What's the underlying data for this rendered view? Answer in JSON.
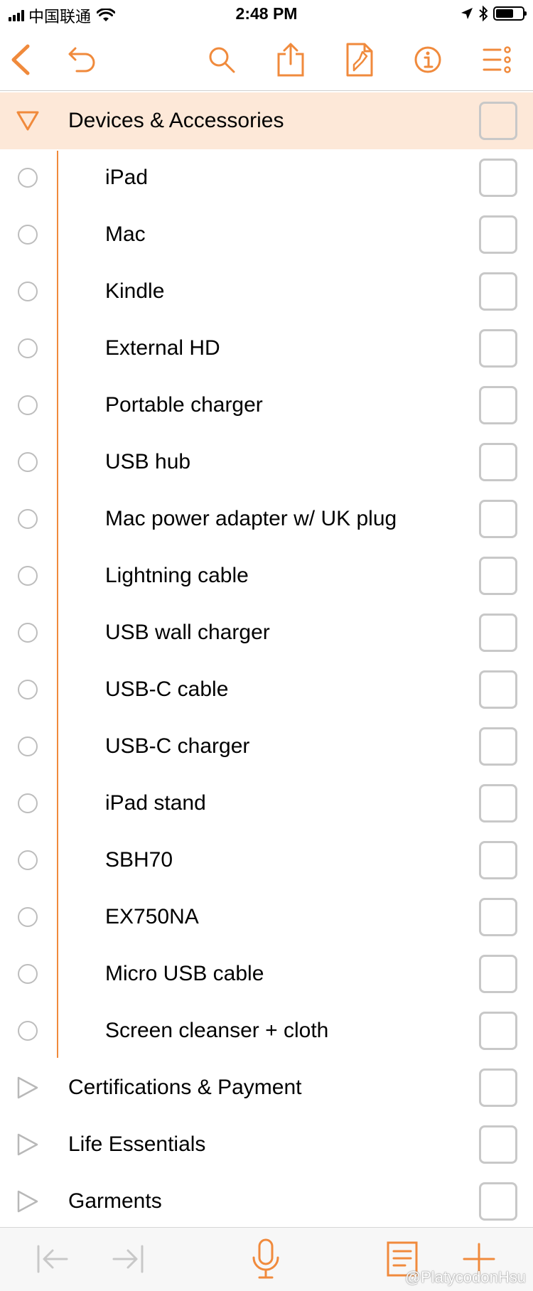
{
  "status_bar": {
    "carrier": "中国联通",
    "time": "2:48 PM"
  },
  "toolbar": {
    "icons": [
      "back-icon",
      "undo-icon",
      "search-icon",
      "share-icon",
      "style-brush-icon",
      "info-icon",
      "outline-menu-icon"
    ]
  },
  "accent_color": "#f08a3c",
  "selected_row_bg": "#fde8d8",
  "outline": {
    "section": {
      "label": "Devices & Accessories",
      "expanded": true,
      "checked": false
    },
    "items": [
      {
        "label": "iPad",
        "checked": false
      },
      {
        "label": "Mac",
        "checked": false
      },
      {
        "label": "Kindle",
        "checked": false
      },
      {
        "label": "External HD",
        "checked": false
      },
      {
        "label": "Portable charger",
        "checked": false
      },
      {
        "label": "USB hub",
        "checked": false
      },
      {
        "label": "Mac power adapter w/ UK plug",
        "checked": false
      },
      {
        "label": "Lightning cable",
        "checked": false
      },
      {
        "label": "USB wall charger",
        "checked": false
      },
      {
        "label": "USB-C cable",
        "checked": false
      },
      {
        "label": "USB-C charger",
        "checked": false
      },
      {
        "label": "iPad stand",
        "checked": false
      },
      {
        "label": "SBH70",
        "checked": false
      },
      {
        "label": "EX750NA",
        "checked": false
      },
      {
        "label": "Micro USB cable",
        "checked": false
      },
      {
        "label": "Screen cleanser + cloth",
        "checked": false
      }
    ],
    "collapsed_sections": [
      {
        "label": "Certifications & Payment",
        "expanded": false,
        "checked": false
      },
      {
        "label": "Life Essentials",
        "expanded": false,
        "checked": false
      },
      {
        "label": "Garments",
        "expanded": false,
        "checked": false
      }
    ]
  },
  "bottom_bar": {
    "icons": [
      "outdent-icon",
      "indent-icon",
      "microphone-icon",
      "add-note-icon",
      "add-row-icon"
    ]
  },
  "watermark": "@PlatycodonHsu"
}
